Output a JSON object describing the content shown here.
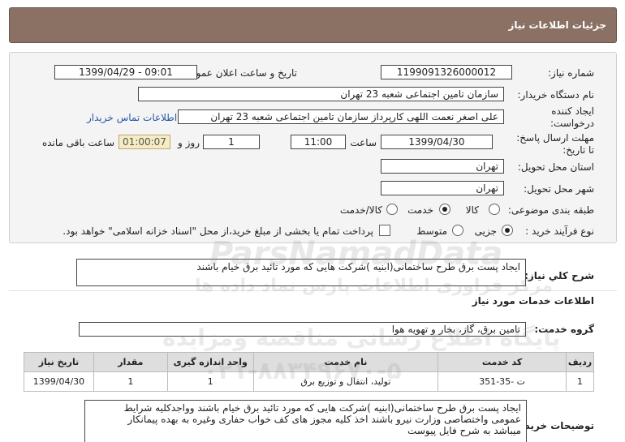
{
  "header": {
    "title": "جزئیات اطلاعات نیاز"
  },
  "fields": {
    "need_number_label": "شماره نیاز:",
    "need_number": "1199091326000012",
    "announce_label": "تاریخ و ساعت اعلان عمومی:",
    "announce_value": "1399/04/29 - 09:01",
    "buyer_org_label": "نام دستگاه خریدار:",
    "buyer_org": "سازمان تامین اجتماعی شعبه 23 تهران",
    "creator_label_1": "ایجاد کننده",
    "creator_label_2": "درخواست:",
    "creator": "علی اصغر نعمت اللهی کارپرداز سازمان تامین اجتماعی شعبه 23 تهران",
    "contact_link": "اطلاعات تماس خریدار",
    "deadline_label_1": "مهلت ارسال پاسخ:",
    "deadline_label_2": "تا تاریخ:",
    "deadline_date": "1399/04/30",
    "time_label": "ساعت",
    "deadline_time": "11:00",
    "days_value": "1",
    "days_label": "روز و",
    "countdown": "01:00:07",
    "remaining_label": "ساعت باقی مانده",
    "province_label": "استان محل تحویل:",
    "province": "تهران",
    "city_label": "شهر محل تحویل:",
    "city": "تهران",
    "category_label": "طبقه بندی موضوعی:",
    "category_options": {
      "goods": "کالا",
      "service": "خدمت",
      "goods_service": "کالا/خدمت"
    },
    "process_label": "نوع فرآیند خرید :",
    "process_options": {
      "partial": "جزیی",
      "medium": "متوسط"
    },
    "payment_note": "پرداخت تمام یا بخشی از مبلغ خرید،از محل \"اسناد خزانه اسلامی\" خواهد بود."
  },
  "summary": {
    "label": "شرح کلي نياز:",
    "text": "ایجاد پست برق طرح ساختمانی(ابنیه )شرکت هایی که مورد تائید برق خیام باشند"
  },
  "services_info": {
    "title": "اطلاعات خدمات مورد نیاز",
    "group_label": "گروه خدمت:",
    "group_value": "تامین برق، گاز، بخار و تهویه هوا"
  },
  "table": {
    "headers": [
      "ردیف",
      "کد خدمت",
      "نام خدمت",
      "واحد اندازه گیری",
      "مقدار",
      "تاریخ نیاز"
    ],
    "rows": [
      [
        "1",
        "ت -35-351",
        "تولید، انتقال و توزیع برق",
        "1",
        "1",
        "1399/04/30"
      ]
    ]
  },
  "buyer_notes": {
    "label": "توضیحات خریدار:",
    "lines": [
      "ایجاد پست برق طرح ساختمانی(ابنیه )شرکت هایی که مورد تائید برق خیام باشند وواجدکلیه شرایط",
      "عمومی واختصاصی وزارت نیرو باشند اخذ کلیه مجوز های کف خواب حفاری وغیره به بهده پیمانکار",
      "میباشد به شرح فایل پیوست"
    ]
  },
  "watermark": {
    "brand": "ParsNamadData",
    "line1": "مرکز فراوری اطلاعات پارس نماد داده ها",
    "line2": "پایگاه اطلاع رسانی مناقصه ومزایده",
    "phone": "۰۲۱-۸۸۳۴۹۶۷۰-۵"
  },
  "colors": {
    "header_bg": "#8b7064",
    "countdown_bg": "#f5ecc4",
    "link": "#2757a6"
  }
}
